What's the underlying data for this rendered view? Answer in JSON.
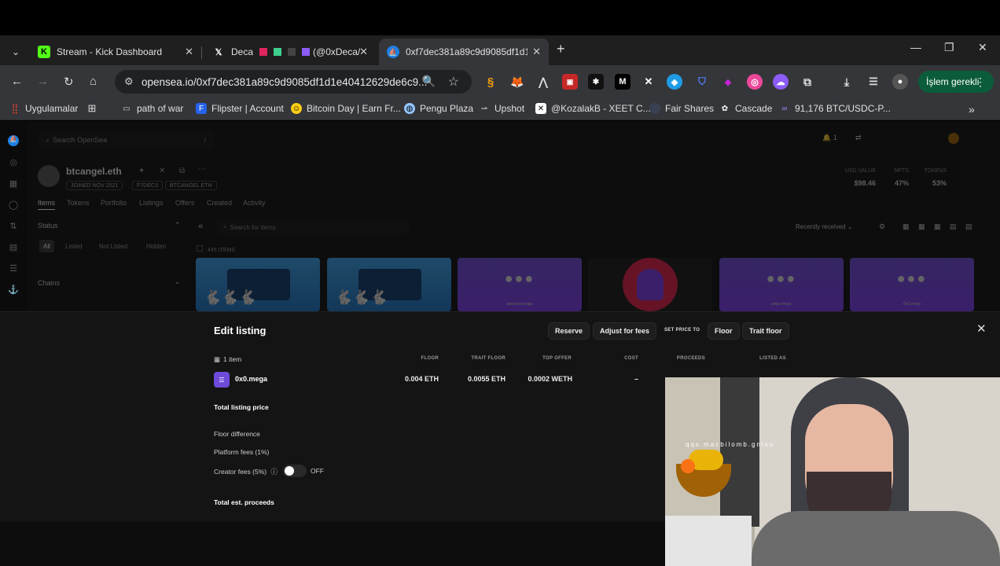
{
  "browser": {
    "tabs": [
      {
        "title": "Stream - Kick Dashboard",
        "icon": "kick-icon"
      },
      {
        "title": "Deca",
        "icon": "x-icon"
      },
      {
        "title": "(@0xDeca/",
        "icon": "x-icon"
      },
      {
        "title": "0xf7dec381a89c9d9085df1d1e4",
        "icon": "opensea-icon"
      }
    ],
    "url": "opensea.io/0xf7dec381a89c9d9085df1d1e40412629de6c9...",
    "update_label": "İşlem gerekli",
    "bookmarks": [
      {
        "label": "Uygulamalar"
      },
      {
        "label": "path of war"
      },
      {
        "label": "Flipster | Account"
      },
      {
        "label": "Bitcoin Day | Earn Fr..."
      },
      {
        "label": "Pengu Plaza"
      },
      {
        "label": "Upshot"
      },
      {
        "label": "@KozalakB - XEET C..."
      },
      {
        "label": "Fair Shares"
      },
      {
        "label": "Cascade"
      },
      {
        "label": "91,176 BTC/USDC-P..."
      }
    ],
    "colors": {
      "accent": "#0b5c3a",
      "tab_active": "#35363a",
      "kick_green": "#53fc18"
    }
  },
  "opensea": {
    "search_placeholder": "Search OpenSea",
    "search_shortcut": "/",
    "notif_count": "1",
    "profile": {
      "name": "btcangel.eth",
      "pills": [
        "JOINED NOV 2021",
        "F7DEC3",
        "BTCANGEL.ETH"
      ],
      "stats": [
        {
          "label": "USD VALUE",
          "value": "$98.46"
        },
        {
          "label": "NFTS",
          "value": "47%"
        },
        {
          "label": "TOKENS",
          "value": "53%"
        }
      ]
    },
    "tabs": [
      "Items",
      "Tokens",
      "Portfolio",
      "Listings",
      "Offers",
      "Created",
      "Activity"
    ],
    "filters": {
      "status_label": "Status",
      "chips": [
        "All",
        "Listed",
        "Not Listed",
        "Hidden"
      ],
      "chains_label": "Chains"
    },
    "items_search_placeholder": "Search for items",
    "sort_label": "Recently received",
    "items_count": "445 ITEMS",
    "cards": [
      {
        "label": ""
      },
      {
        "label": ""
      },
      {
        "label": "opensea.mega"
      },
      {
        "label": ""
      },
      {
        "label": "pepe.mega"
      },
      {
        "label": "0x0.mega"
      }
    ]
  },
  "modal": {
    "title": "Edit listing",
    "buttons": {
      "reserve": "Reserve",
      "adjust": "Adjust for fees",
      "set_price_to": "SET PRICE TO",
      "floor": "Floor",
      "trait_floor": "Trait floor"
    },
    "item_count": "1 item",
    "headers": {
      "floor": "FLOOR",
      "trait_floor": "TRAIT FLOOR",
      "top_offer": "TOP OFFER",
      "cost": "COST",
      "proceeds": "PROCEEDS",
      "listed_as": "LISTED AS"
    },
    "row": {
      "name": "0x0.mega",
      "floor": "0.004 ETH",
      "trait_floor": "0.0055 ETH",
      "top_offer": "0.0002 WETH",
      "cost": "–",
      "proceeds": ""
    },
    "labels": {
      "total_listing_price": "Total listing price",
      "floor_difference": "Floor difference",
      "platform_fees": "Platform fees (1%)",
      "creator_fees": "Creator fees (5%)",
      "creator_toggle": "OFF",
      "total_est_proceeds": "Total est. proceeds"
    }
  },
  "webcam": {
    "overlay_text": "qqs.macbilomb.gnisu"
  }
}
